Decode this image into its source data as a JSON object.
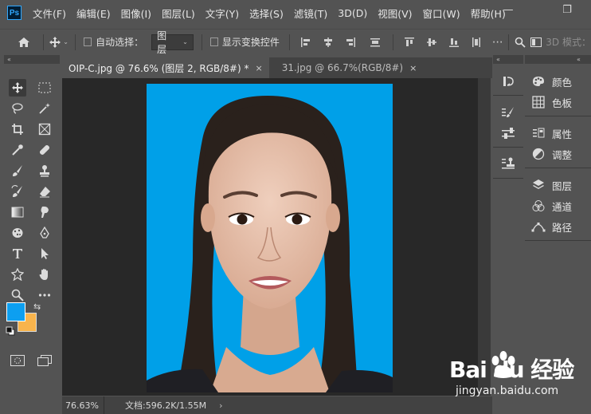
{
  "menubar": {
    "app_icon": "Ps",
    "items": [
      "文件(F)",
      "编辑(E)",
      "图像(I)",
      "图层(L)",
      "文字(Y)",
      "选择(S)",
      "滤镜(T)",
      "3D(D)",
      "视图(V)",
      "窗口(W)",
      "帮助(H)"
    ],
    "minimize": "—",
    "restore": "❐"
  },
  "options": {
    "auto_select_label": "自动选择：",
    "auto_select_target": "图层",
    "show_transform_label": "显示变换控件",
    "mode_3d_label": "3D 模式："
  },
  "tabs": [
    {
      "label": "OIP-C.jpg @ 76.6% (图层 2, RGB/8#) *",
      "close": "×"
    },
    {
      "label": "31.jpg @ 66.7%(RGB/8#)",
      "close": "×"
    }
  ],
  "status": {
    "zoom": "76.63%",
    "doc_info": "文档:596.2K/1.55M",
    "more": "›"
  },
  "panels": {
    "group1": [
      {
        "label": "颜色",
        "icon": "palette-icon"
      },
      {
        "label": "色板",
        "icon": "swatches-icon"
      }
    ],
    "group2": [
      {
        "label": "属性",
        "icon": "properties-icon"
      },
      {
        "label": "调整",
        "icon": "adjustments-icon"
      }
    ],
    "group3": [
      {
        "label": "图层",
        "icon": "layers-icon"
      },
      {
        "label": "通道",
        "icon": "channels-icon"
      },
      {
        "label": "路径",
        "icon": "paths-icon"
      }
    ]
  },
  "colors": {
    "foreground": "#0d9ff0",
    "background": "#f8b44c",
    "photo_backdrop": "#00a0e8"
  },
  "watermark": {
    "brand": "Bai du 经验",
    "url": "jingyan.baidu.com"
  },
  "collapse_arrows": {
    "left": "«",
    "middle": "«",
    "right": "«"
  }
}
